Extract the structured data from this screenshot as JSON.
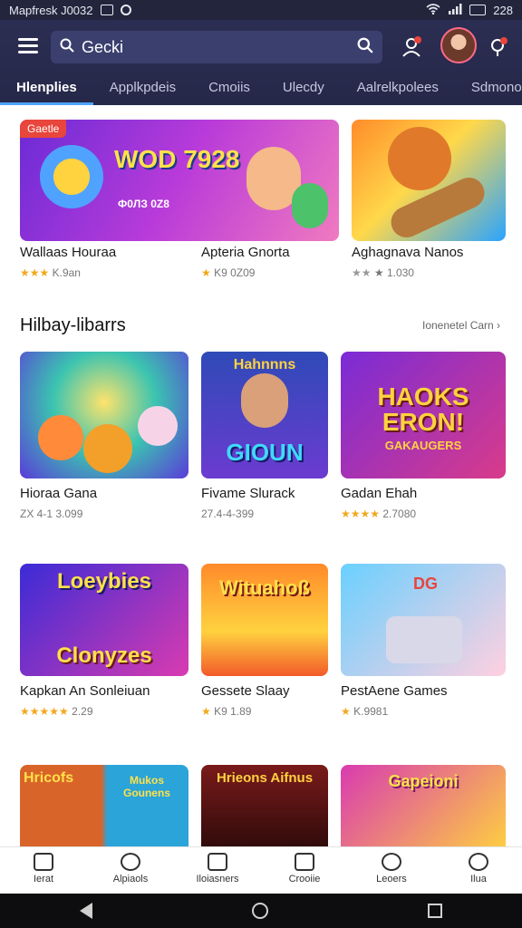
{
  "status_bar": {
    "left_text": "Mapfresk J0032",
    "right_text": "228"
  },
  "search": {
    "value": "Gecki"
  },
  "tabs": [
    {
      "label": "Hlenplies"
    },
    {
      "label": "Applkpdeis"
    },
    {
      "label": "Cmoiis"
    },
    {
      "label": "Ulecdy"
    },
    {
      "label": "Aalrelkpolees"
    },
    {
      "label": "Sdmonoolcr"
    }
  ],
  "featured": [
    {
      "title": "Wallaas Houraa",
      "rating": "★★★",
      "rating_text": "K.9an",
      "badge": "Gaetle",
      "art_text": "WOD 7928",
      "art_sub": "Ф0ЛЗ 0Z8"
    },
    {
      "title": "Apteria Gnorta",
      "rating": "★",
      "rating_text": "K9 0Z09"
    },
    {
      "title": "Aghagnava Nanos",
      "rating": "★★",
      "rating_text": "★ 1.030"
    }
  ],
  "section": {
    "title": "Hilbay-libarrs",
    "link": "Ionenetel Carn ›"
  },
  "grid": [
    {
      "title": "Hioraa Gana",
      "rating": "",
      "rating_text": "ZX 4-1 3.099"
    },
    {
      "title": "Fivame Slurack",
      "rating": "",
      "rating_text": "27.4-4-399",
      "art_text": "GIOUN",
      "art_top": "Hahnnns"
    },
    {
      "title": "Gadan Ehah",
      "rating": "★★★★",
      "rating_text": "2.7080",
      "art_text": "HAOKS ERON!",
      "art_sub": "GAKAUGERS"
    },
    {
      "title": "Kapkan An Sonleiuan",
      "rating": "★★★★★",
      "rating_text": "2.29",
      "art_text": "Clonyzes",
      "art_top": "Loeybies"
    },
    {
      "title": "Gessete Slaay",
      "rating": "★",
      "rating_text": "K9 1.89",
      "art_text": "Wituahoß"
    },
    {
      "title": "PestAene Games",
      "rating": "★",
      "rating_text": "K.9981",
      "art_text": "DG"
    },
    {
      "title": "",
      "rating": "",
      "rating_text": "",
      "art_text": "Hricofs",
      "art_sub": "Mukos Gounens"
    },
    {
      "title": "",
      "rating": "",
      "rating_text": "",
      "art_text": "Hrieons Aifnus"
    },
    {
      "title": "",
      "rating": "",
      "rating_text": "",
      "art_text": "Gapeioni"
    }
  ],
  "bottom_nav": [
    {
      "label": "Ierat",
      "icon": "home-icon"
    },
    {
      "label": "Alpiaols",
      "icon": "circle-icon"
    },
    {
      "label": "Iloiasners",
      "icon": "house-icon"
    },
    {
      "label": "Crooiie",
      "icon": "square-icon"
    },
    {
      "label": "Leoers",
      "icon": "chat-icon"
    },
    {
      "label": "Ilua",
      "icon": "link-icon"
    }
  ],
  "colors": {
    "header_bg": "#2b2e52",
    "accent": "#4fa3ff",
    "star": "#f2a81d",
    "badge": "#e8453c"
  }
}
